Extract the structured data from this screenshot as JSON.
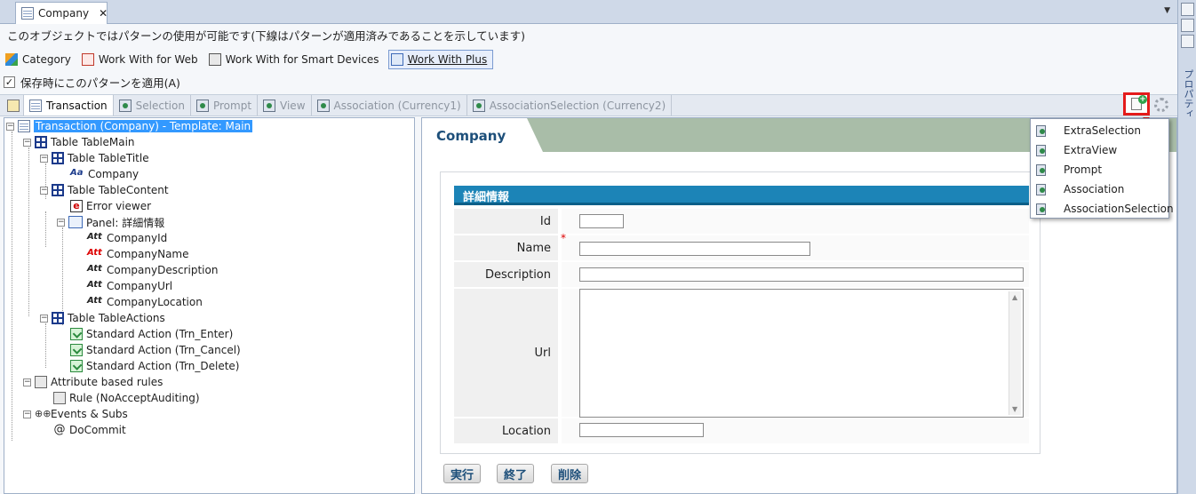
{
  "doc_tab": {
    "label": "Company",
    "close": "✕"
  },
  "pattern_notice": "このオブジェクトではパターンの使用が可能です(下線はパターンが適用済みであることを示しています)",
  "pattern_tabs": [
    {
      "label": "Category"
    },
    {
      "label": "Work With for Web"
    },
    {
      "label": "Work With for Smart Devices"
    },
    {
      "label": "Work With Plus"
    }
  ],
  "apply_checkbox": {
    "label": "保存時にこのパターンを適用(A)",
    "checked": "✓"
  },
  "sub_tabs": [
    {
      "label": "Transaction"
    },
    {
      "label": "Selection"
    },
    {
      "label": "Prompt"
    },
    {
      "label": "View"
    },
    {
      "label": "Association (Currency1)"
    },
    {
      "label": "AssociationSelection (Currency2)"
    }
  ],
  "tree": {
    "root": "Transaction (Company) - Template: Main",
    "table_main": "Table TableMain",
    "table_title": "Table TableTitle",
    "company_text": "Company",
    "table_content": "Table TableContent",
    "error_viewer": "Error viewer",
    "panel": "Panel: 詳細情報",
    "att_id": "CompanyId",
    "att_name": "CompanyName",
    "att_desc": "CompanyDescription",
    "att_url": "CompanyUrl",
    "att_loc": "CompanyLocation",
    "table_actions": "Table TableActions",
    "act_enter": "Standard Action (Trn_Enter)",
    "act_cancel": "Standard Action (Trn_Cancel)",
    "act_delete": "Standard Action (Trn_Delete)",
    "rules": "Attribute based rules",
    "rule_item": "Rule (NoAcceptAuditing)",
    "events": "Events & Subs",
    "docommit": "DoCommit",
    "att_icon_text": "Att",
    "text_icon_text": "Aa",
    "err_icon_text": "e",
    "at_icon_text": "@",
    "events_icon_text": "⊕⊕",
    "expand_minus": "−",
    "expand_plus": "+"
  },
  "preview": {
    "title": "Company",
    "section_header": "詳細情報",
    "fields": [
      {
        "label": "Id"
      },
      {
        "label": "Name"
      },
      {
        "label": "Description"
      },
      {
        "label": "Url"
      },
      {
        "label": "Location"
      }
    ],
    "required_mark": "*",
    "buttons": {
      "enter": "実行",
      "close": "終了",
      "delete": "削除"
    }
  },
  "menu": {
    "items": [
      "ExtraSelection",
      "ExtraView",
      "Prompt",
      "Association",
      "AssociationSelection"
    ]
  },
  "right_strip": {
    "label": "プロパティ"
  },
  "colors": {
    "highlight_red": "#e41b1b",
    "selection_blue": "#3399ff",
    "header_blue": "#1c84b7"
  }
}
